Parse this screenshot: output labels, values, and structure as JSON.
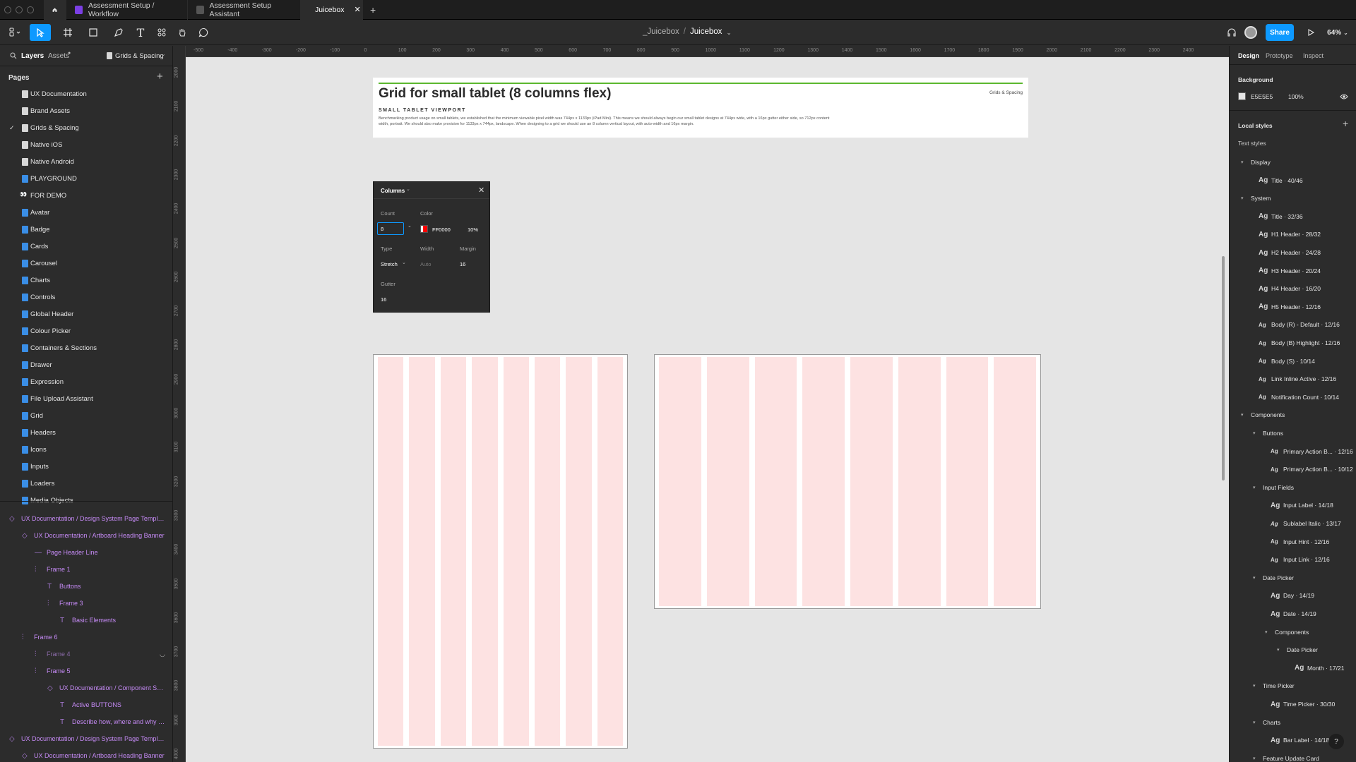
{
  "tabs": [
    {
      "label": "Assessment Setup / Workflow"
    },
    {
      "label": "Assessment Setup Assistant"
    },
    {
      "label": "Juicebox"
    }
  ],
  "toolbar": {
    "breadcrumb_project": "_Juicebox",
    "breadcrumb_sep": "/",
    "file_name": "Juicebox",
    "share_label": "Share",
    "zoom": "64%"
  },
  "left": {
    "tab_layers": "Layers",
    "tab_assets": "Assets",
    "current_page": "Grids & Spacing",
    "pages_title": "Pages",
    "pages": [
      "UX Documentation",
      "Brand Assets",
      "Grids & Spacing",
      "Native iOS",
      "Native Android",
      "PLAYGROUND",
      "FOR DEMO",
      "Avatar",
      "Badge",
      "Cards",
      "Carousel",
      "Charts",
      "Controls",
      "Global Header",
      "Colour Picker",
      "Containers & Sections",
      "Drawer",
      "Expression",
      "File Upload Assistant",
      "Grid",
      "Headers",
      "Icons",
      "Inputs",
      "Loaders",
      "Media Objects"
    ],
    "layers": [
      "UX Documentation / Design System Page Template",
      "UX Documentation / Artboard Heading Banner",
      "Page Header Line",
      "Frame 1",
      "Buttons",
      "Frame 3",
      "Basic Elements",
      "Frame 6",
      "Frame 4",
      "Frame 5",
      "UX Documentation / Component Set ...",
      "Active BUTTONS",
      "Describe how, where and why w...",
      "UX Documentation / Design System Page Template",
      "UX Documentation / Artboard Heading Banner"
    ]
  },
  "rulers": {
    "h": [
      "-500",
      "-400",
      "-300",
      "-200",
      "-100",
      "0",
      "100",
      "200",
      "300",
      "400",
      "500",
      "600",
      "700",
      "800",
      "900",
      "1000",
      "1100",
      "1200",
      "1300",
      "1400",
      "1500",
      "1600",
      "1700",
      "1800",
      "1900",
      "2000",
      "2100",
      "2200",
      "2300",
      "2400"
    ],
    "v": [
      "2000",
      "2100",
      "2200",
      "2300",
      "2400",
      "2500",
      "2600",
      "2700",
      "2800",
      "2900",
      "3000",
      "3100",
      "3200",
      "3300",
      "3400",
      "3500",
      "3600",
      "3700",
      "3800",
      "3900",
      "4000"
    ]
  },
  "banner": {
    "title": "Grid for small tablet (8 columns flex)",
    "tag": "Grids & Spacing",
    "subtitle": "SMALL TABLET VIEWPORT",
    "body": "Benchmarking product usage on small tablets, we established that the minimum viewable pixel width was 744px x 1133px (iPad Mini). This means we should always begin our small tablet designs at 744px wide, with a 16px gutter either side, so 712px content width, portrait. We should also make provision for 1133px x 744px, landscape. When designing to a grid we should use an 8 column vertical layout, with auto-width and 16px margin."
  },
  "columns_panel": {
    "title": "Columns",
    "count_label": "Count",
    "count_value": "8",
    "color_label": "Color",
    "color_hex": "FF0000",
    "color_opacity": "10%",
    "type_label": "Type",
    "type_value": "Stretch",
    "width_label": "Width",
    "width_value": "Auto",
    "margin_label": "Margin",
    "margin_value": "16",
    "gutter_label": "Gutter",
    "gutter_value": "16",
    "color_swatch": "#ff0000"
  },
  "grid_frames": {
    "portrait_columns": 8,
    "landscape_columns": 8,
    "column_color": "#fde2e2"
  },
  "right": {
    "tab_design": "Design",
    "tab_prototype": "Prototype",
    "tab_inspect": "Inspect",
    "background_label": "Background",
    "bg_hex": "E5E5E5",
    "bg_opacity": "100%",
    "local_styles": "Local styles",
    "text_styles": "Text styles",
    "styles": [
      {
        "kind": "group",
        "label": "Display"
      },
      {
        "kind": "style",
        "label": "Title · 40/46"
      },
      {
        "kind": "group",
        "label": "System"
      },
      {
        "kind": "style",
        "label": "Title · 32/36"
      },
      {
        "kind": "style",
        "label": "H1 Header · 28/32"
      },
      {
        "kind": "style",
        "label": "H2 Header · 24/28"
      },
      {
        "kind": "style",
        "label": "H3 Header · 20/24"
      },
      {
        "kind": "style",
        "label": "H4 Header · 16/20"
      },
      {
        "kind": "style",
        "label": "H5 Header · 12/16"
      },
      {
        "kind": "style",
        "label": "Body (R) - Default · 12/16"
      },
      {
        "kind": "style",
        "label": "Body (B) Highlight · 12/16"
      },
      {
        "kind": "style",
        "label": "Body (S) · 10/14"
      },
      {
        "kind": "style",
        "label": "Link Inline Active · 12/16"
      },
      {
        "kind": "style",
        "label": "Notification Count · 10/14"
      },
      {
        "kind": "group",
        "label": "Components"
      },
      {
        "kind": "sub",
        "label": "Buttons"
      },
      {
        "kind": "substyle",
        "label": "Primary Action B... · 12/16"
      },
      {
        "kind": "substyle",
        "label": "Primary Action B... · 10/12"
      },
      {
        "kind": "sub",
        "label": "Input Fields"
      },
      {
        "kind": "substyle",
        "label": "Input Label · 14/18"
      },
      {
        "kind": "substyle",
        "label": "Sublabel Italic · 13/17"
      },
      {
        "kind": "substyle",
        "label": "Input Hint · 12/16"
      },
      {
        "kind": "substyle",
        "label": "Input Link · 12/16"
      },
      {
        "kind": "sub",
        "label": "Date Picker"
      },
      {
        "kind": "substyle",
        "label": "Day · 14/19"
      },
      {
        "kind": "substyle",
        "label": "Date · 14/19"
      },
      {
        "kind": "sub2",
        "label": "Components"
      },
      {
        "kind": "sub3",
        "label": "Date Picker"
      },
      {
        "kind": "substyle3",
        "label": "Month · 17/21"
      },
      {
        "kind": "sub",
        "label": "Time Picker"
      },
      {
        "kind": "substyle",
        "label": "Time Picker · 30/30"
      },
      {
        "kind": "sub",
        "label": "Charts"
      },
      {
        "kind": "substyle",
        "label": "Bar Label · 14/18"
      },
      {
        "kind": "sub",
        "label": "Feature Update Card"
      }
    ],
    "ag": "Ag",
    "help": "?"
  }
}
